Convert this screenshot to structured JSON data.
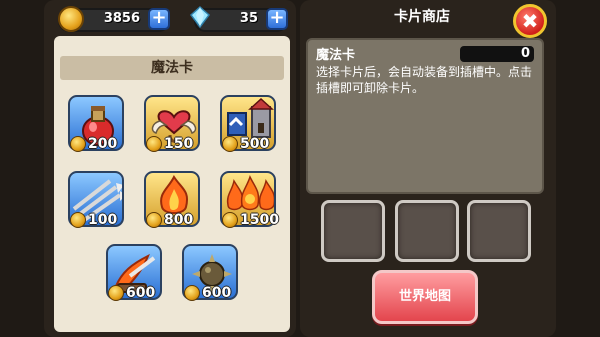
{
  "currency": {
    "gold": "3856",
    "gems": "35"
  },
  "left_panel": {
    "title": "魔法卡"
  },
  "cards": [
    {
      "price": "200",
      "icon": "potion-icon"
    },
    {
      "price": "150",
      "icon": "winged-heart-icon"
    },
    {
      "price": "500",
      "icon": "castle-icon"
    },
    {
      "price": "100",
      "icon": "arrows-icon"
    },
    {
      "price": "800",
      "icon": "fire-bomb-icon"
    },
    {
      "price": "1500",
      "icon": "triple-fire-icon"
    },
    {
      "price": "600",
      "icon": "fire-sword-icon"
    },
    {
      "price": "600",
      "icon": "spiked-ball-icon"
    }
  ],
  "shop": {
    "title": "卡片商店",
    "info_title": "魔法卡",
    "count": "0",
    "description": "选择卡片后，会自动装备到插槽中。点击插槽即可卸除卡片。",
    "world_map_label": "世界地图"
  },
  "colors": {
    "accent_blue": "#2a6fd3",
    "gold_tile": "#d5a02c",
    "map_button": "#e3454d",
    "panel_bg": "#eee7d6"
  }
}
